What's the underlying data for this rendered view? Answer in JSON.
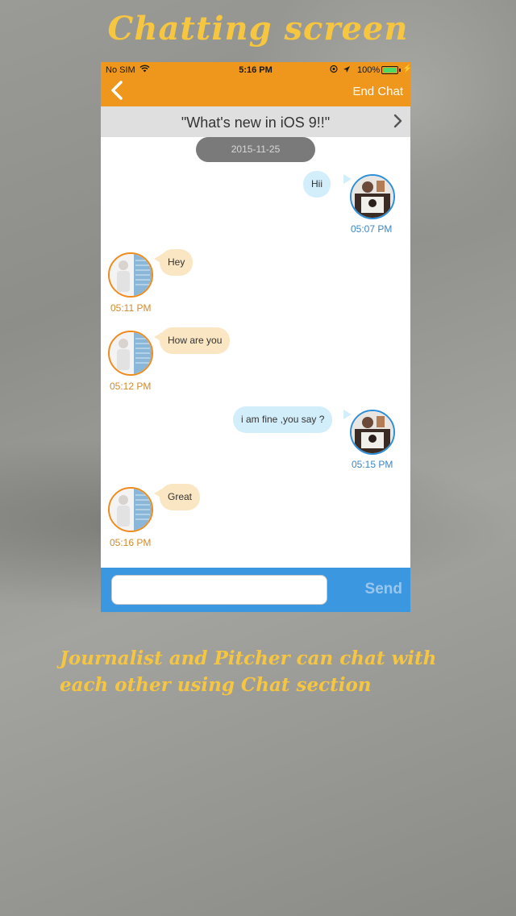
{
  "promo": {
    "headline": "Chatting screen",
    "caption": "Journalist and Pitcher can chat with each other using Chat section"
  },
  "status_bar": {
    "carrier": "No SIM",
    "time": "5:16 PM",
    "battery": "100%"
  },
  "nav": {
    "end_chat": "End Chat"
  },
  "topic": {
    "title": "\"What's new in iOS 9!!\""
  },
  "date_separator": "2015-11-25",
  "messages": [
    {
      "sender": "me",
      "text": "Hii",
      "time": "05:07 PM"
    },
    {
      "sender": "them",
      "text": "Hey",
      "time": "05:11 PM"
    },
    {
      "sender": "them",
      "text": "How are you",
      "time": "05:12 PM"
    },
    {
      "sender": "me",
      "text": "i am fine ,you say ?",
      "time": "05:15 PM"
    },
    {
      "sender": "them",
      "text": "Great",
      "time": "05:16 PM"
    }
  ],
  "composer": {
    "placeholder": "",
    "send_label": "Send"
  },
  "colors": {
    "nav_orange": "#ef961c",
    "input_blue": "#3b97e0",
    "my_bubble": "#d3eefb",
    "their_bubble": "#fbe6c3",
    "promo_yellow": "#f6c640"
  }
}
